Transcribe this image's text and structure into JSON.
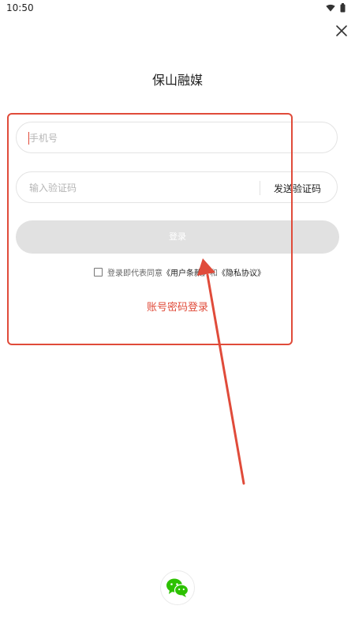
{
  "status_bar": {
    "time": "10:50",
    "wifi_icon": "wifi-icon",
    "battery_icon": "battery-icon"
  },
  "header": {
    "close_icon": "close-icon",
    "title": "保山融媒"
  },
  "form": {
    "phone_placeholder": "手机号",
    "code_placeholder": "输入验证码",
    "send_code_label": "发送验证码",
    "login_label": "登录"
  },
  "agreement": {
    "text_prefix": "登录即代表同意",
    "terms_link": "《用户条款》",
    "and": "和",
    "privacy_link": "《隐私协议》",
    "checked": false
  },
  "alt_login": {
    "account_password_label": "账号密码登录"
  },
  "social": {
    "wechat_icon": "wechat-icon"
  },
  "colors": {
    "accent": "#e04b3a",
    "button_disabled": "#e1e1e1",
    "wechat_green": "#2dc100"
  }
}
